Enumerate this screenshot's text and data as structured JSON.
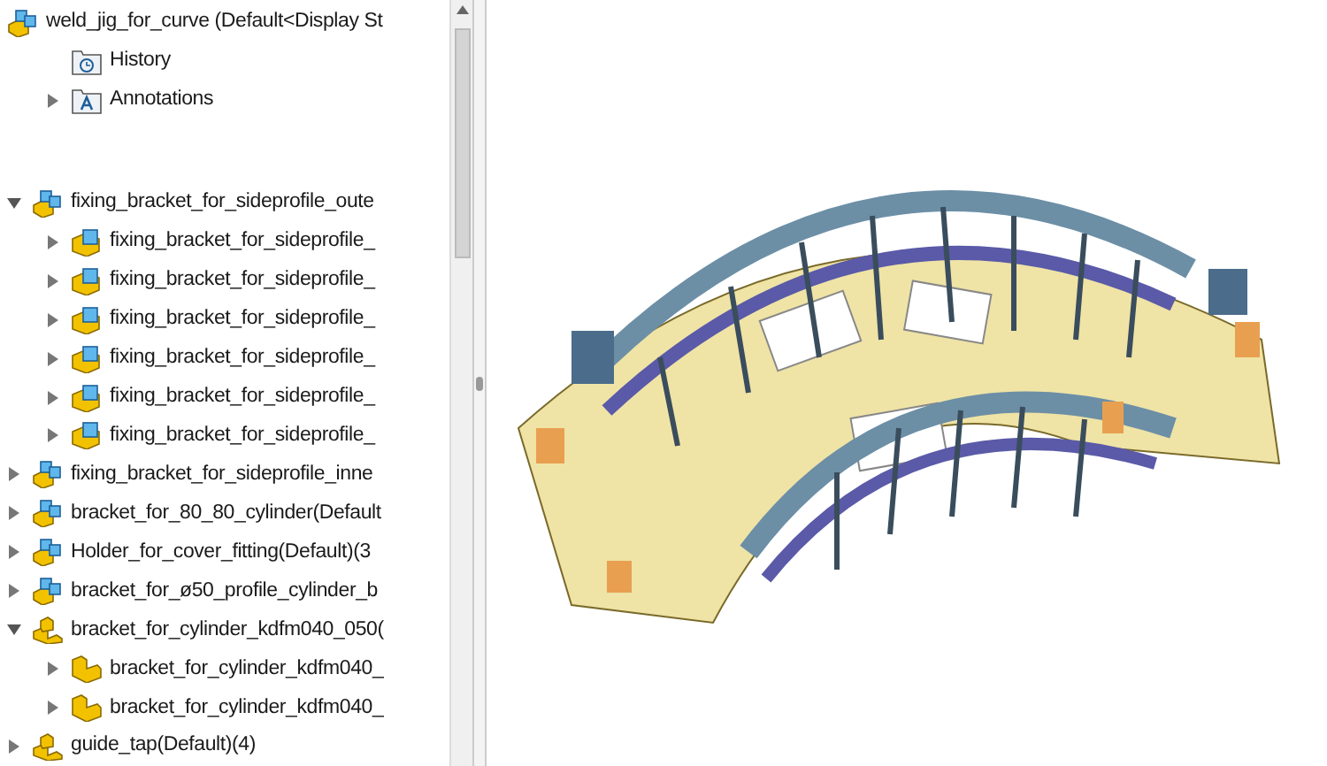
{
  "tree": {
    "root": {
      "label": "weld_jig_for_curve  (Default<Display St",
      "kind": "assembly"
    },
    "top_items": [
      {
        "label": "History",
        "kind": "history"
      },
      {
        "label": "Annotations",
        "kind": "annotations",
        "expanded": false
      }
    ],
    "items": [
      {
        "label": "fixing_bracket_for_sideprofile_oute",
        "kind": "assembly",
        "expanded": true,
        "children": [
          {
            "label": "fixing_bracket_for_sideprofile_",
            "kind": "part",
            "expanded": false
          },
          {
            "label": "fixing_bracket_for_sideprofile_",
            "kind": "part",
            "expanded": false
          },
          {
            "label": "fixing_bracket_for_sideprofile_",
            "kind": "part",
            "expanded": false
          },
          {
            "label": "fixing_bracket_for_sideprofile_",
            "kind": "part",
            "expanded": false
          },
          {
            "label": "fixing_bracket_for_sideprofile_",
            "kind": "part",
            "expanded": false
          },
          {
            "label": "fixing_bracket_for_sideprofile_",
            "kind": "part",
            "expanded": false
          }
        ]
      },
      {
        "label": "fixing_bracket_for_sideprofile_inne",
        "kind": "assembly",
        "expanded": false
      },
      {
        "label": "bracket_for_80_80_cylinder(Default",
        "kind": "assembly",
        "expanded": false
      },
      {
        "label": "Holder_for_cover_fitting(Default)(3",
        "kind": "assembly",
        "expanded": false
      },
      {
        "label": "bracket_for_ø50_profile_cylinder_b",
        "kind": "assembly",
        "expanded": false
      },
      {
        "label": "bracket_for_cylinder_kdfm040_050(",
        "kind": "subassembly",
        "expanded": true,
        "children": [
          {
            "label": "bracket_for_cylinder_kdfm040_",
            "kind": "bracket",
            "expanded": false
          },
          {
            "label": "bracket_for_cylinder_kdfm040_",
            "kind": "bracket",
            "expanded": false
          }
        ]
      },
      {
        "label": "guide_tap(Default)(4)",
        "kind": "subassembly",
        "expanded": false
      }
    ]
  }
}
